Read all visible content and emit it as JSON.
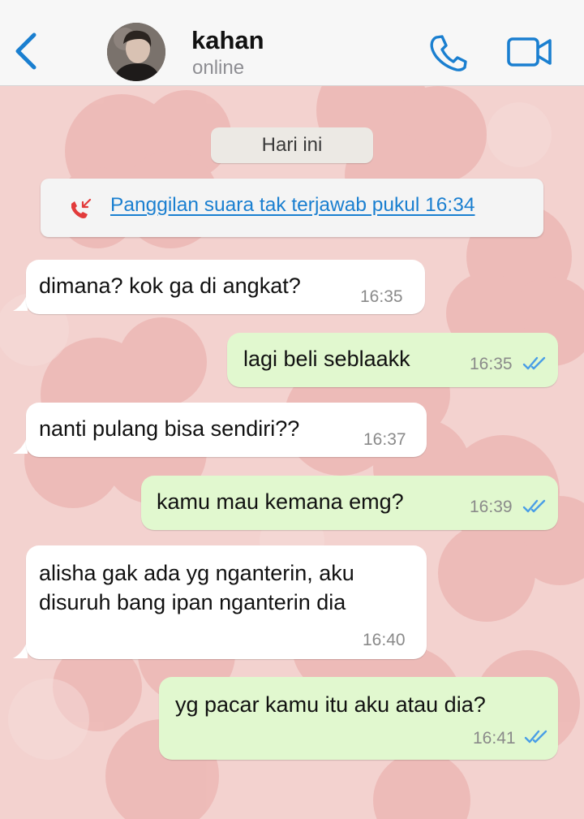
{
  "header": {
    "contact_name": "kahan",
    "contact_status": "online",
    "icons": {
      "back": "chevron-left-icon",
      "call": "phone-icon",
      "video": "video-camera-icon"
    },
    "accent_color": "#1a7fd0"
  },
  "chat": {
    "date_label": "Hari ini",
    "missed_call": {
      "text": "Panggilan suara tak terjawab pukul 16:34",
      "icon": "missed-call-icon",
      "color": "#e23b3b"
    },
    "messages": [
      {
        "direction": "incoming",
        "text": "dimana? kok ga di angkat?",
        "time": "16:35"
      },
      {
        "direction": "outgoing",
        "text": "lagi beli seblaakk",
        "time": "16:35",
        "read": true
      },
      {
        "direction": "incoming",
        "text": "nanti pulang bisa sendiri??",
        "time": "16:37"
      },
      {
        "direction": "outgoing",
        "text": "kamu mau kemana emg?",
        "time": "16:39",
        "read": true
      },
      {
        "direction": "incoming",
        "lines": [
          "alisha gak ada yg nganterin, aku",
          "disuruh bang ipan nganterin dia"
        ],
        "time": "16:40"
      },
      {
        "direction": "outgoing",
        "text": "yg pacar kamu itu aku atau dia?",
        "time": "16:41",
        "read": true
      }
    ],
    "colors": {
      "incoming_bubble": "#ffffff",
      "outgoing_bubble": "#e1f8cf",
      "wallpaper": "#f3d2cf",
      "read_ticks": "#4a9ee6"
    }
  }
}
